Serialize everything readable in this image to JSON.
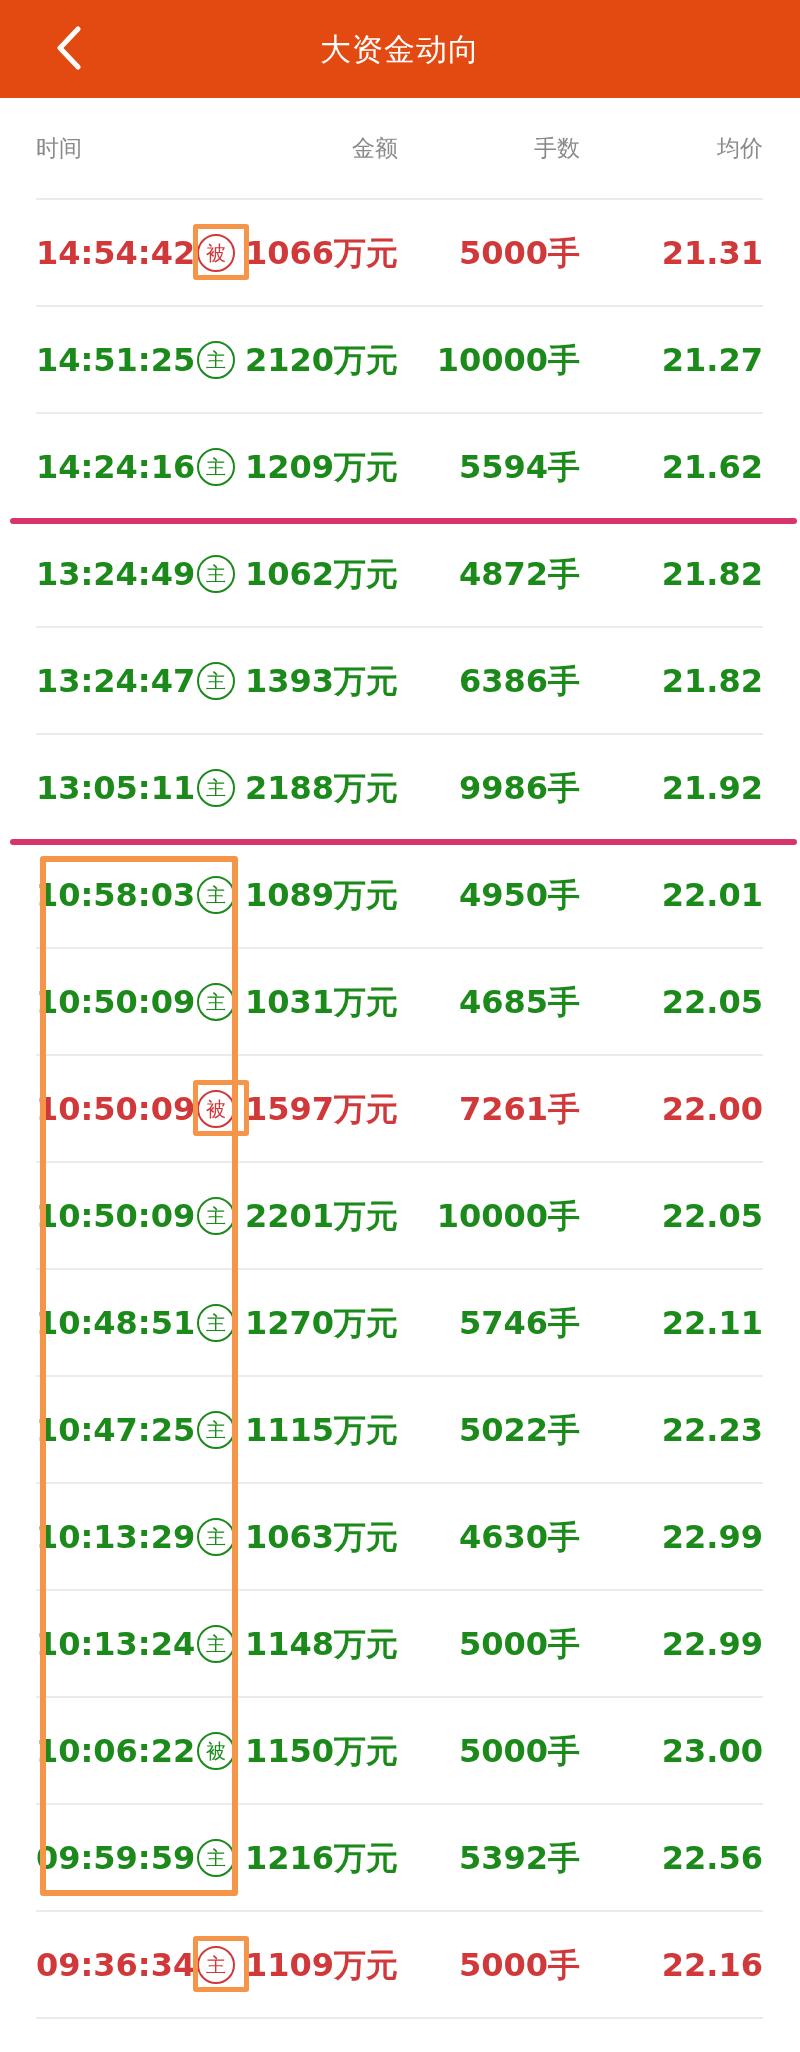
{
  "title": "大资金动向",
  "columns": [
    "时间",
    "金额",
    "手数",
    "均价"
  ],
  "blocks": [
    {
      "time_boxed": false,
      "rows": [
        {
          "time": "14:54:42",
          "tag": "被",
          "amount": "1066万元",
          "volume": "5000手",
          "price": "21.31",
          "color": "#d0383a",
          "tag_boxed": true,
          "line_after": false
        },
        {
          "time": "14:51:25",
          "tag": "主",
          "amount": "2120万元",
          "volume": "10000手",
          "price": "21.27",
          "color": "#1b8a1b",
          "tag_boxed": false,
          "line_after": false
        },
        {
          "time": "14:24:16",
          "tag": "主",
          "amount": "1209万元",
          "volume": "5594手",
          "price": "21.62",
          "color": "#1b8a1b",
          "tag_boxed": false,
          "line_after": true
        },
        {
          "time": "13:24:49",
          "tag": "主",
          "amount": "1062万元",
          "volume": "4872手",
          "price": "21.82",
          "color": "#1b8a1b",
          "tag_boxed": false,
          "line_after": false
        },
        {
          "time": "13:24:47",
          "tag": "主",
          "amount": "1393万元",
          "volume": "6386手",
          "price": "21.82",
          "color": "#1b8a1b",
          "tag_boxed": false,
          "line_after": false
        },
        {
          "time": "13:05:11",
          "tag": "主",
          "amount": "2188万元",
          "volume": "9986手",
          "price": "21.92",
          "color": "#1b8a1b",
          "tag_boxed": false,
          "line_after": true
        }
      ]
    },
    {
      "time_boxed": true,
      "rows": [
        {
          "time": "10:58:03",
          "tag": "主",
          "amount": "1089万元",
          "volume": "4950手",
          "price": "22.01",
          "color": "#1b8a1b",
          "tag_boxed": false,
          "line_after": false
        },
        {
          "time": "10:50:09",
          "tag": "主",
          "amount": "1031万元",
          "volume": "4685手",
          "price": "22.05",
          "color": "#1b8a1b",
          "tag_boxed": false,
          "line_after": false
        },
        {
          "time": "10:50:09",
          "tag": "被",
          "amount": "1597万元",
          "volume": "7261手",
          "price": "22.00",
          "color": "#d0383a",
          "tag_boxed": true,
          "line_after": false
        },
        {
          "time": "10:50:09",
          "tag": "主",
          "amount": "2201万元",
          "volume": "10000手",
          "price": "22.05",
          "color": "#1b8a1b",
          "tag_boxed": false,
          "line_after": false
        },
        {
          "time": "10:48:51",
          "tag": "主",
          "amount": "1270万元",
          "volume": "5746手",
          "price": "22.11",
          "color": "#1b8a1b",
          "tag_boxed": false,
          "line_after": false
        },
        {
          "time": "10:47:25",
          "tag": "主",
          "amount": "1115万元",
          "volume": "5022手",
          "price": "22.23",
          "color": "#1b8a1b",
          "tag_boxed": false,
          "line_after": false
        },
        {
          "time": "10:13:29",
          "tag": "主",
          "amount": "1063万元",
          "volume": "4630手",
          "price": "22.99",
          "color": "#1b8a1b",
          "tag_boxed": false,
          "line_after": false
        },
        {
          "time": "10:13:24",
          "tag": "主",
          "amount": "1148万元",
          "volume": "5000手",
          "price": "22.99",
          "color": "#1b8a1b",
          "tag_boxed": false,
          "line_after": false
        },
        {
          "time": "10:06:22",
          "tag": "被",
          "amount": "1150万元",
          "volume": "5000手",
          "price": "23.00",
          "color": "#1b8a1b",
          "tag_boxed": false,
          "line_after": false
        },
        {
          "time": "09:59:59",
          "tag": "主",
          "amount": "1216万元",
          "volume": "5392手",
          "price": "22.56",
          "color": "#1b8a1b",
          "tag_boxed": false,
          "line_after": false
        }
      ]
    },
    {
      "time_boxed": false,
      "rows": [
        {
          "time": "09:36:34",
          "tag": "主",
          "amount": "1109万元",
          "volume": "5000手",
          "price": "22.16",
          "color": "#d0383a",
          "tag_boxed": true,
          "line_after": false
        }
      ]
    }
  ]
}
